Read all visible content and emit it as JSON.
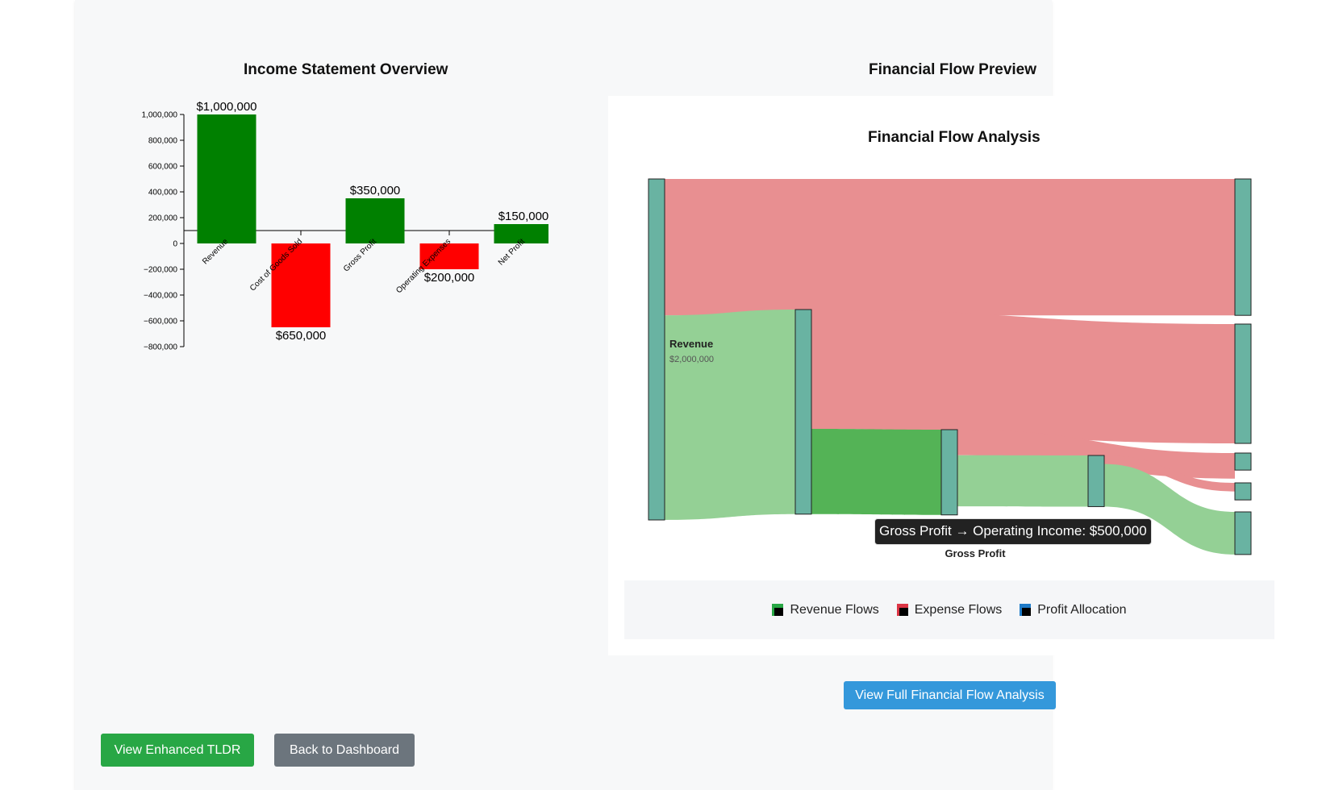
{
  "page": {
    "income_title": "Income Statement Overview",
    "flow_preview_title": "Financial Flow Preview"
  },
  "chart_data": [
    {
      "type": "bar",
      "subtype": "waterfall",
      "title": "Income Statement Overview",
      "categories": [
        "Revenue",
        "Cost of Goods Sold",
        "Gross Profit",
        "Operating Expenses",
        "Net Profit"
      ],
      "values": [
        1000000,
        -650000,
        350000,
        -200000,
        150000
      ],
      "data_labels": [
        "$1,000,000",
        "$650,000",
        "$350,000",
        "$200,000",
        "$150,000"
      ],
      "ylim": [
        -800000,
        1000000
      ],
      "yticks": [
        1000000,
        800000,
        600000,
        400000,
        200000,
        0,
        -200000,
        -400000,
        -600000,
        -800000
      ],
      "ytick_labels": [
        "1,000,000",
        "800,000",
        "600,000",
        "400,000",
        "200,000",
        "0",
        "−200,000",
        "−400,000",
        "−600,000",
        "−800,000"
      ],
      "colors": {
        "positive": "#008000",
        "negative": "#ff0000"
      },
      "grid": false
    },
    {
      "type": "sankey",
      "title": "Financial Flow Analysis",
      "nodes": [
        {
          "id": "revenue",
          "name": "Revenue",
          "value_label": "$2,000,000",
          "value": 2000000
        },
        {
          "id": "n1",
          "value": 1200000
        },
        {
          "id": "gross-profit",
          "name": "Gross Profit",
          "value": 500000
        },
        {
          "id": "operating-income",
          "name": "Operating Income",
          "value": 300000
        },
        {
          "id": "t1",
          "value": 800000
        },
        {
          "id": "t2",
          "value": 700000
        },
        {
          "id": "t3",
          "value": 100000
        },
        {
          "id": "t4",
          "value": 100000
        },
        {
          "id": "t5",
          "value": 250000
        }
      ],
      "links": [
        {
          "source": "revenue",
          "target": "t1",
          "value": 800000,
          "kind": "expense"
        },
        {
          "source": "revenue",
          "target": "n1",
          "value": 1200000,
          "kind": "revenue"
        },
        {
          "source": "n1",
          "target": "t2",
          "value": 700000,
          "kind": "expense"
        },
        {
          "source": "n1",
          "target": "gross-profit",
          "value": 500000,
          "kind": "revenue-strong"
        },
        {
          "source": "gross-profit",
          "target": "t3",
          "value": 150000,
          "kind": "expense"
        },
        {
          "source": "gross-profit",
          "target": "operating-income",
          "value": 300000,
          "kind": "revenue"
        },
        {
          "source": "operating-income",
          "target": "t4",
          "value": 50000,
          "kind": "expense"
        },
        {
          "source": "operating-income",
          "target": "t5",
          "value": 250000,
          "kind": "revenue"
        }
      ],
      "tooltip": "Gross Profit → Operating Income: $500,000",
      "bottom_label": "Gross Profit",
      "colors": {
        "node": "#69b3a2",
        "expense": "#e88f91",
        "revenue": "#94d095",
        "revenue-strong": "#54b356"
      }
    }
  ],
  "legend": [
    {
      "label": "Revenue Flows",
      "color": "#28a745"
    },
    {
      "label": "Expense Flows",
      "color": "#dc3545"
    },
    {
      "label": "Profit Allocation",
      "color": "#1f7bc8"
    }
  ],
  "buttons": {
    "full_flow": "View Full Financial Flow Analysis",
    "tldr": "View Enhanced TLDR",
    "back": "Back to Dashboard"
  }
}
